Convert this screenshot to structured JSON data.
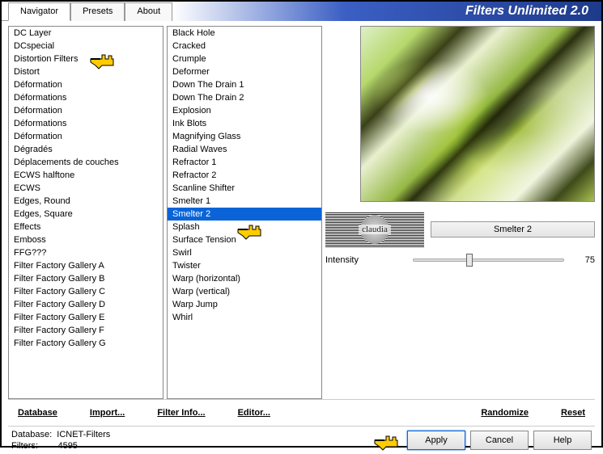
{
  "header": {
    "title": "Filters Unlimited 2.0",
    "tabs": [
      {
        "label": "Navigator",
        "active": true
      },
      {
        "label": "Presets",
        "active": false
      },
      {
        "label": "About",
        "active": false
      }
    ]
  },
  "categories": [
    "DC Layer",
    "DCspecial",
    "Distortion Filters",
    "Distort",
    "Déformation",
    "Déformations",
    "Déformation",
    "Déformations",
    "Déformation",
    "Dégradés",
    "Déplacements de couches",
    "ECWS halftone",
    "ECWS",
    "Edges, Round",
    "Edges, Square",
    "Effects",
    "Emboss",
    "FFG???",
    "Filter Factory Gallery A",
    "Filter Factory Gallery B",
    "Filter Factory Gallery C",
    "Filter Factory Gallery D",
    "Filter Factory Gallery E",
    "Filter Factory Gallery F",
    "Filter Factory Gallery G"
  ],
  "category_highlight_index": 2,
  "filters": [
    "Black Hole",
    "Cracked",
    "Crumple",
    "Deformer",
    "Down The Drain 1",
    "Down The Drain 2",
    "Explosion",
    "Ink Blots",
    "Magnifying Glass",
    "Radial Waves",
    "Refractor 1",
    "Refractor 2",
    "Scanline Shifter",
    "Smelter 1",
    "Smelter 2",
    "Splash",
    "Surface Tension",
    "Swirl",
    "Twister",
    "Warp (horizontal)",
    "Warp (vertical)",
    "Warp Jump",
    "Whirl"
  ],
  "filter_selected_index": 14,
  "selected_filter_name": "Smelter 2",
  "watermark_text": "claudia",
  "sliders": [
    {
      "label": "Intensity",
      "value": 75
    }
  ],
  "col_buttons_left": [
    "Database",
    "Import...",
    "Filter Info...",
    "Editor..."
  ],
  "col_buttons_right": [
    "Randomize",
    "Reset"
  ],
  "status": {
    "db_label": "Database:",
    "db_value": "ICNET-Filters",
    "filters_label": "Filters:",
    "filters_value": "4595"
  },
  "actions": {
    "apply": "Apply",
    "cancel": "Cancel",
    "help": "Help"
  }
}
